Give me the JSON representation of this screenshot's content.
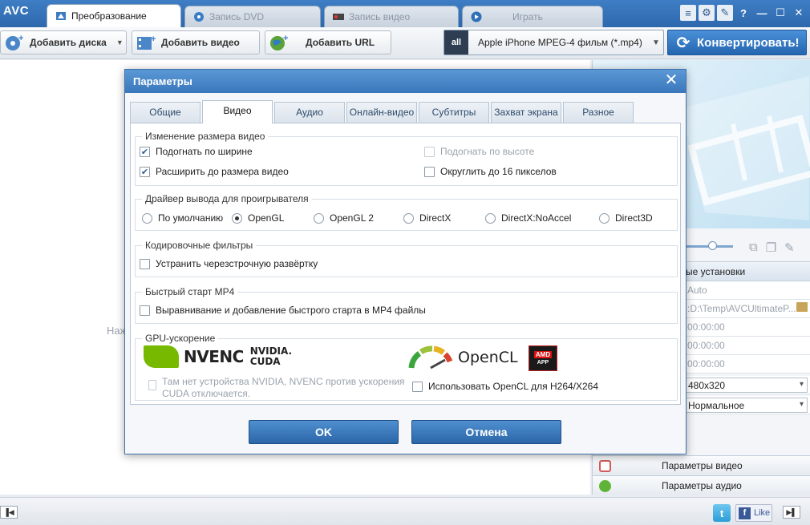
{
  "app": {
    "logo": "AVC"
  },
  "tabs": [
    {
      "label": "Преобразование",
      "icon": "convert-icon"
    },
    {
      "label": "Запись DVD",
      "icon": "disc-icon"
    },
    {
      "label": "Запись видео",
      "icon": "record-icon"
    },
    {
      "label": "Играть",
      "icon": "play-icon"
    }
  ],
  "toolbar": {
    "add_disc": "Добавить диска",
    "add_video": "Добавить видео",
    "add_url": "Добавить URL",
    "profile_icon_text": "all",
    "profile": "Apple iPhone MPEG-4 фильм (*.mp4)",
    "convert": "Конвертировать!"
  },
  "main": {
    "hint": "Наж"
  },
  "right_panel": {
    "basic_settings": "ые установки",
    "rows": [
      "Auto",
      ":D:\\Temp\\AVCUltimateP...",
      "00:00:00",
      "00:00:00",
      "00:00:00"
    ],
    "size_select": "480x320",
    "quality_select": "Нормальное",
    "video_params": "Параметры видео",
    "audio_params": "Параметры аудио"
  },
  "bottom": {
    "like": "Like"
  },
  "dialog": {
    "title": "Параметры",
    "tabs": [
      "Общие",
      "Видео",
      "Аудио",
      "Онлайн-видео",
      "Субтитры",
      "Захват экрана",
      "Разное"
    ],
    "active_tab": "Видео",
    "resize": {
      "label": "Изменение размера видео",
      "fit_width": "Подогнать по ширине",
      "fit_height": "Подогнать по высоте",
      "expand": "Расширить до размера видео",
      "round16": "Округлить до 16 пикселов"
    },
    "driver": {
      "label": "Драйвер вывода для проигрывателя",
      "options": [
        "По умолчанию",
        "OpenGL",
        "OpenGL 2",
        "DirectX",
        "DirectX:NoAccel",
        "Direct3D"
      ],
      "selected": "OpenGL"
    },
    "filters": {
      "label": "Кодировочные фильтры",
      "deinterlace": "Устранить черезстрочную развёртку"
    },
    "mp4": {
      "label": "Быстрый старт MP4",
      "faststart": "Выравнивание и добавление быстрого старта в MP4 файлы"
    },
    "gpu": {
      "label": "GPU-ускорение",
      "nvenc_logo": "NVENC",
      "nvidia_logo": "NVIDIA.",
      "cuda_logo": "CUDA",
      "opencl_logo": "OpenCL",
      "amd_logo": "AMD",
      "amd_sub": "APP",
      "no_device": "Там нет устройства NVIDIA, NVENC против ускорения CUDA отключается.",
      "use_opencl": "Использовать OpenCL для H264/X264"
    },
    "ok": "OK",
    "cancel": "Отмена"
  },
  "colors": {
    "accent": "#2d68ad",
    "nvidia": "#76b900",
    "amd": "#dd1111"
  }
}
